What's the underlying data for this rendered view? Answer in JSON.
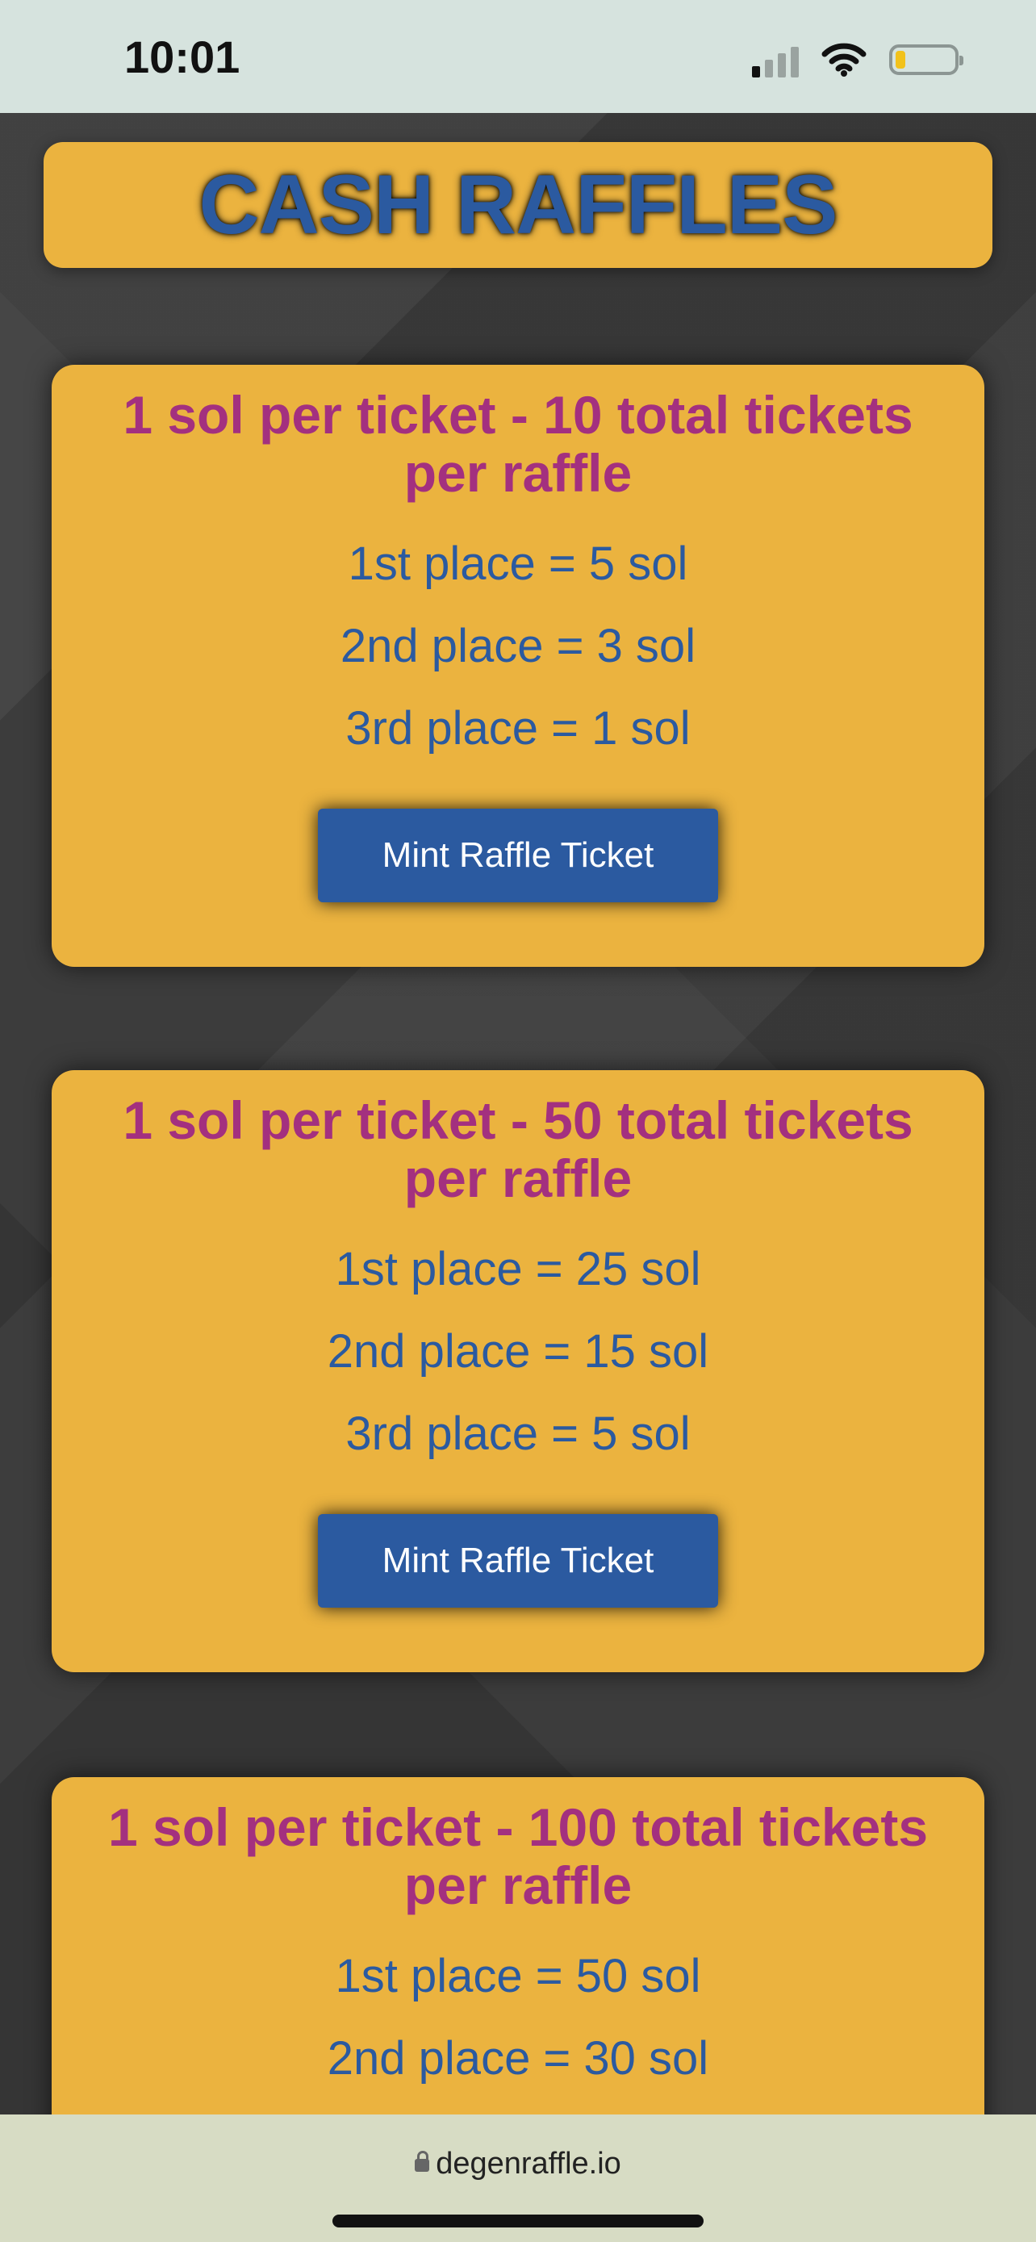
{
  "status_bar": {
    "time": "10:01"
  },
  "title": "CASH RAFFLES",
  "raffles": [
    {
      "heading": "1 sol per ticket - 10 total tickets per raffle",
      "prizes": [
        "1st place = 5 sol",
        "2nd place = 3 sol",
        "3rd place = 1 sol"
      ],
      "button": "Mint Raffle Ticket"
    },
    {
      "heading": "1 sol per ticket - 50 total tickets per raffle",
      "prizes": [
        "1st place = 25 sol",
        "2nd place = 15 sol",
        "3rd place = 5 sol"
      ],
      "button": "Mint Raffle Ticket"
    },
    {
      "heading": "1 sol per ticket - 100 total tickets per raffle",
      "prizes": [
        "1st place = 50 sol",
        "2nd place = 30 sol"
      ]
    }
  ],
  "browser": {
    "url": "degenraffle.io"
  },
  "colors": {
    "card": "#ebb33f",
    "heading": "#a3307f",
    "text": "#2b5aa0",
    "button": "#2b5aa0"
  }
}
